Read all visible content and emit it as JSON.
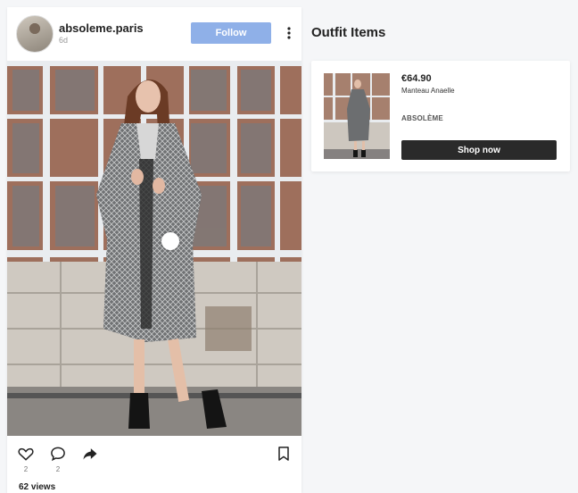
{
  "post": {
    "username": "absoleme.paris",
    "time_ago": "6d",
    "follow_label": "Follow",
    "likes": "2",
    "comments": "2",
    "views": "62 views"
  },
  "outfit": {
    "title": "Outfit Items",
    "items": [
      {
        "price": "€64.90",
        "name": "Manteau Anaelle",
        "brand": "ABSOLÈME",
        "cta": "Shop now"
      }
    ]
  },
  "colors": {
    "follow_button": "#8fb0e8",
    "shop_button": "#2a2a2a",
    "page_background": "#f5f6f8"
  },
  "icons": [
    "more-vertical-icon",
    "heart-icon",
    "comment-icon",
    "share-icon",
    "bookmark-icon"
  ]
}
